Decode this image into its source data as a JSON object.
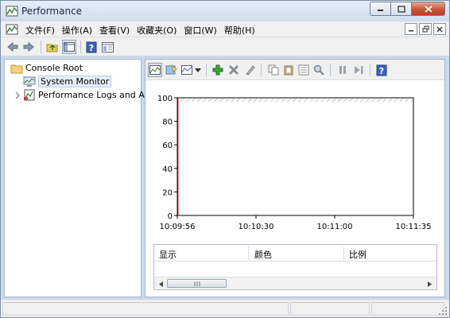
{
  "window": {
    "title": "Performance",
    "icon": "performance-monitor-icon"
  },
  "menu": {
    "items": [
      "文件(F)",
      "操作(A)",
      "查看(V)",
      "收藏夹(O)",
      "窗口(W)",
      "帮助(H)"
    ]
  },
  "toolbar": {
    "icons": [
      "back-arrow-icon",
      "forward-arrow-icon",
      "up-folder-icon",
      "show-hide-tree-icon",
      "help-icon",
      "properties-icon"
    ]
  },
  "tree": {
    "root": "Console Root",
    "items": [
      {
        "label": "System Monitor",
        "icon": "system-monitor-icon",
        "selected": true
      },
      {
        "label": "Performance Logs and Al",
        "icon": "performance-logs-icon",
        "selected": false
      }
    ]
  },
  "monitor_toolbar": {
    "icons": [
      "view-graph-icon",
      "clear-display-icon",
      "change-graph-type-icon",
      "dropdown-arrow-icon",
      "add-counter-icon",
      "delete-counter-icon",
      "highlight-icon",
      "copy-properties-icon",
      "paste-counter-list-icon",
      "properties-icon",
      "zoom-icon",
      "freeze-display-icon",
      "update-data-icon",
      "help-icon"
    ]
  },
  "chart_data": {
    "type": "line",
    "y_ticks": [
      "100",
      "80",
      "60",
      "40",
      "20",
      "0"
    ],
    "ylim": [
      0,
      100
    ],
    "x_ticks": [
      "10:09:56",
      "10:10:30",
      "10:11:00",
      "10:11:35"
    ],
    "series": [],
    "colors": {
      "time_bar": "#e03030",
      "axis": "#000000"
    }
  },
  "counter_list": {
    "columns": [
      "显示",
      "颜色",
      "比例"
    ]
  },
  "colors": {
    "titlebar": "#d6e3f3",
    "pane_border": "#a8b6c8",
    "selection": "#e5eefa",
    "close_button": "#c8553b"
  }
}
